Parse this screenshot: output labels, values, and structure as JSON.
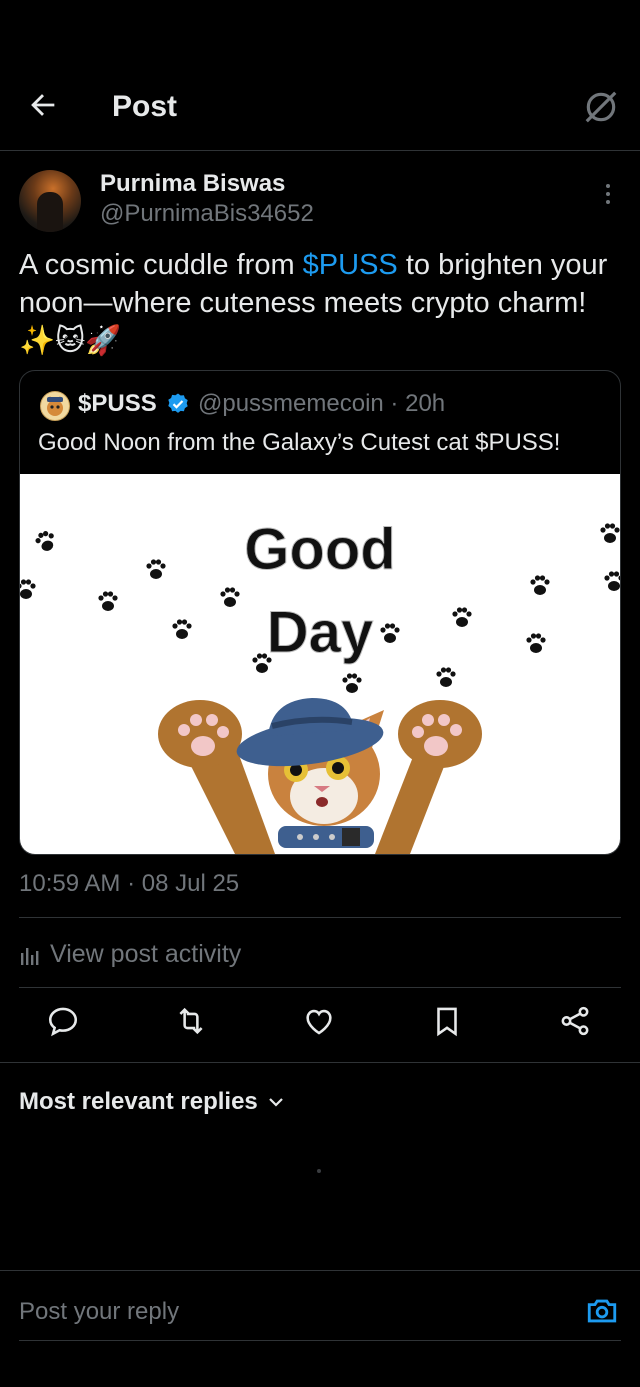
{
  "header": {
    "title": "Post"
  },
  "post": {
    "author_name": "Purnima Biswas",
    "author_handle": "@PurnimaBis34652",
    "text_before": "A cosmic cuddle from ",
    "cashtag": "$PUSS",
    "text_after": " to brighten your noon—where cuteness meets crypto charm! ✨🐱🚀",
    "timestamp": "10:59 AM · 08 Jul 25"
  },
  "quoted_post": {
    "name": "$PUSS",
    "handle_time": "@pussmemecoin · 20h",
    "text": "Good Noon from the Galaxy’s Cutest cat $PUSS!",
    "image_line1": "Good",
    "image_line2": "Day"
  },
  "activity": {
    "label": "View post activity"
  },
  "actions": {
    "icons": [
      "reply-icon",
      "repost-icon",
      "like-icon",
      "bookmark-icon",
      "share-icon"
    ]
  },
  "replies": {
    "sort_label": "Most relevant replies"
  },
  "composer": {
    "placeholder": "Post your reply"
  },
  "colors": {
    "background": "#000000",
    "accent": "#1d9bf0",
    "secondary_text": "#71767b",
    "divider": "#2f3336"
  }
}
